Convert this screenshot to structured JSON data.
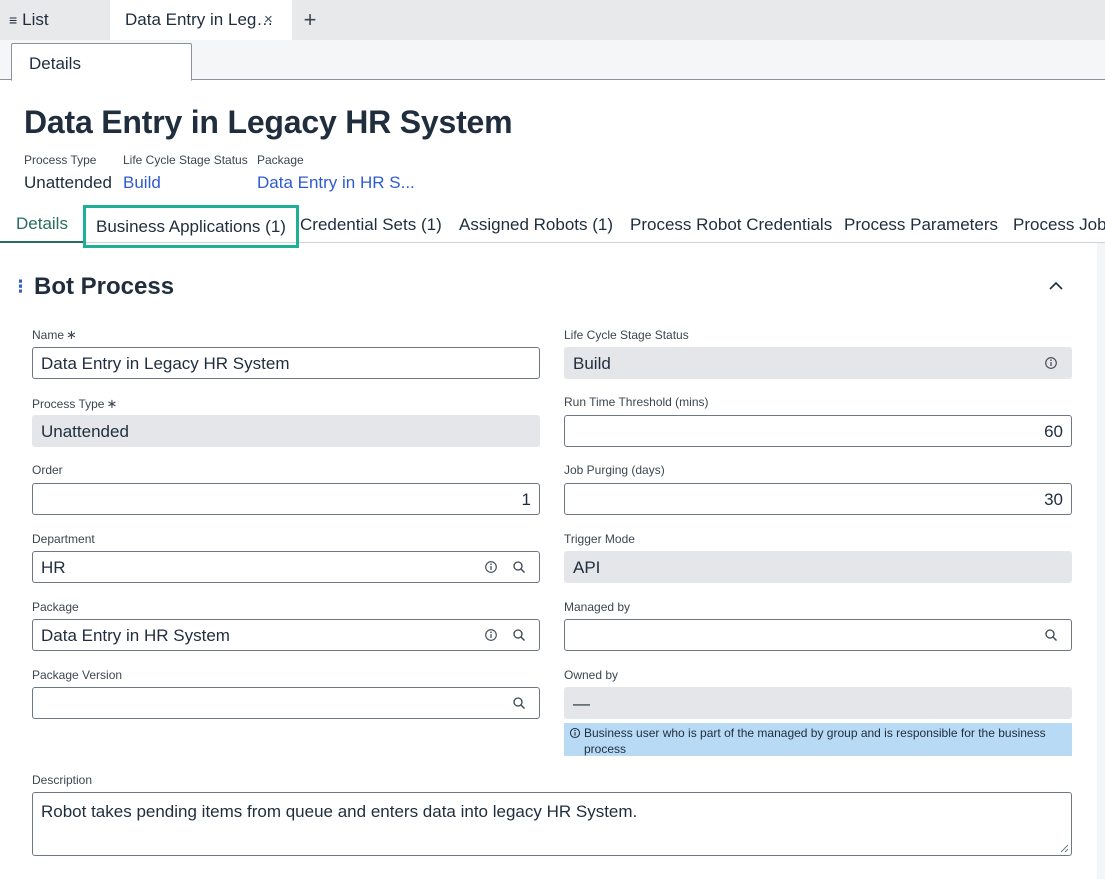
{
  "topbar": {
    "list_tab_icon": "≡",
    "list_tab_label": "List",
    "doc_tab_label": "Data Entry in Leg…",
    "close_glyph": "×",
    "add_glyph": "+"
  },
  "subbar": {
    "details_tab": "Details"
  },
  "header": {
    "title": "Data Entry in Legacy HR System",
    "meta": [
      {
        "label": "Process Type",
        "value": "Unattended"
      },
      {
        "label": "Life Cycle Stage Status",
        "value": "Build"
      },
      {
        "label": "Package",
        "value": "Data Entry in HR S..."
      }
    ]
  },
  "tabs": [
    "Details",
    "Business Applications (1)",
    "Credential Sets (1)",
    "Assigned Robots (1)",
    "Process Robot Credentials",
    "Process Parameters",
    "Process Jobs"
  ],
  "section": {
    "dots": "⋮",
    "title": "Bot Process"
  },
  "form": {
    "req_mark": "∗",
    "name": {
      "label": "Name",
      "value": "Data Entry in Legacy HR System"
    },
    "lifecycle": {
      "label": "Life Cycle Stage Status",
      "value": "Build"
    },
    "process_type": {
      "label": "Process Type",
      "value": "Unattended"
    },
    "run_time": {
      "label": "Run Time Threshold (mins)",
      "value": "60"
    },
    "order": {
      "label": "Order",
      "value": "1"
    },
    "job_purging": {
      "label": "Job Purging (days)",
      "value": "30"
    },
    "department": {
      "label": "Department",
      "value": "HR"
    },
    "trigger_mode": {
      "label": "Trigger Mode",
      "value": "API"
    },
    "package": {
      "label": "Package",
      "value": "Data Entry in HR System"
    },
    "managed_by": {
      "label": "Managed by",
      "value": ""
    },
    "package_version": {
      "label": "Package Version",
      "value": ""
    },
    "owned_by": {
      "label": "Owned by",
      "value": "—"
    },
    "owned_by_help": "Business user who is part of the managed by group and is responsible for the business process",
    "description": {
      "label": "Description",
      "value": "Robot takes pending items from queue and enters data into legacy HR System."
    }
  },
  "colors": {
    "accent": "#2a6d5c",
    "focus": "#1fae96",
    "link": "#2f5bd0",
    "info_bg": "#b9daf4"
  }
}
